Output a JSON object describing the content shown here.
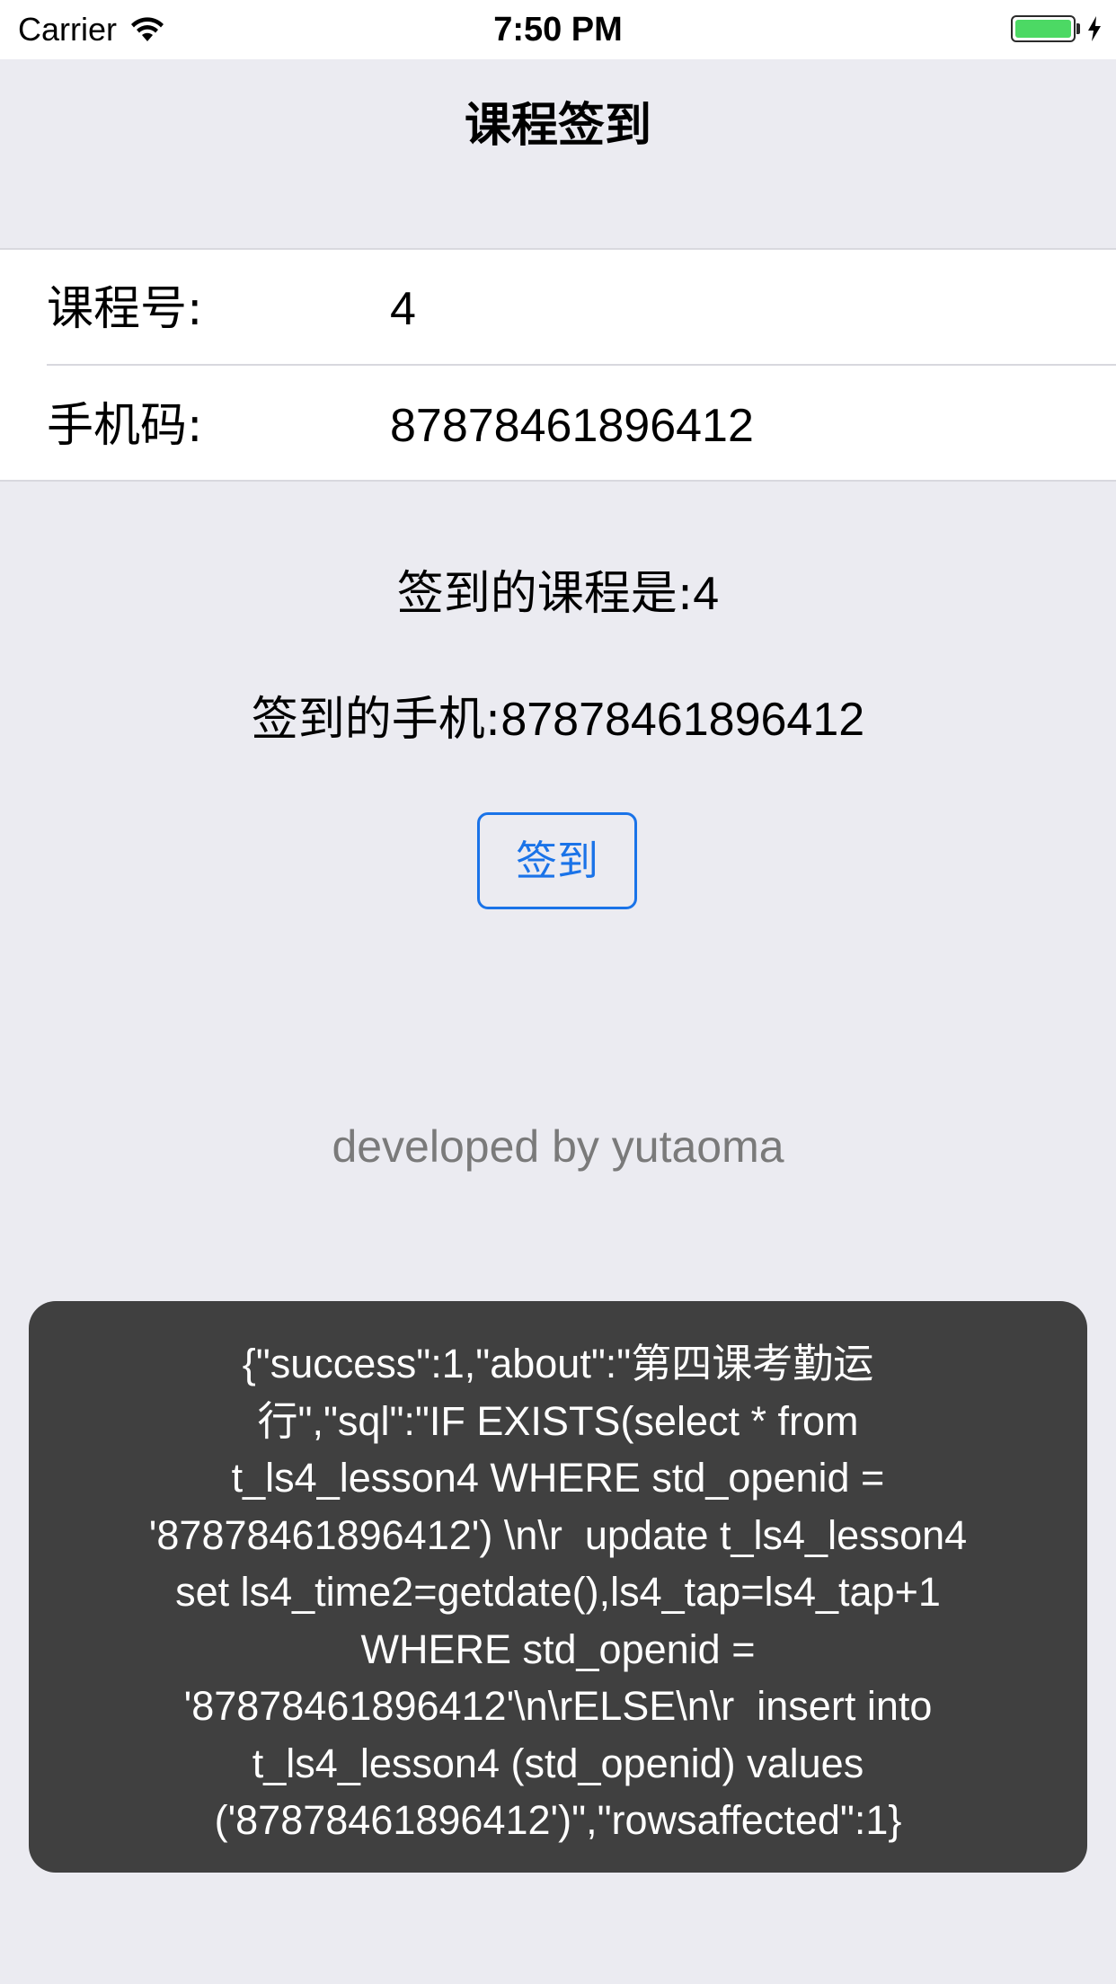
{
  "status_bar": {
    "carrier": "Carrier",
    "time": "7:50 PM",
    "wifi_icon": "wifi-icon",
    "battery_icon": "battery-icon",
    "charging_icon": "bolt-icon",
    "battery_color": "#4cd964"
  },
  "nav": {
    "title": "课程签到"
  },
  "form": {
    "course_label": "课程号:",
    "course_value": "4",
    "phone_label": "手机码:",
    "phone_value": "87878461896412"
  },
  "result": {
    "course_prefix": "签到的课程是:",
    "course_value": "4",
    "phone_prefix": "签到的手机:",
    "phone_value": "87878461896412"
  },
  "actions": {
    "sign_in_label": "签到",
    "accent_color": "#1a73e8"
  },
  "footer": {
    "credit": "developed by yutaoma"
  },
  "toast": {
    "message": "{\"success\":1,\"about\":\"第四课考勤运\n行\",\"sql\":\"IF EXISTS(select * from\nt_ls4_lesson4 WHERE std_openid =\n'87878461896412') \\n\\r  update t_ls4_lesson4\nset ls4_time2=getdate(),ls4_tap=ls4_tap+1\nWHERE std_openid =\n'87878461896412'\\n\\rELSE\\n\\r  insert into\nt_ls4_lesson4 (std_openid) values\n('87878461896412')\",\"rowsaffected\":1}"
  }
}
